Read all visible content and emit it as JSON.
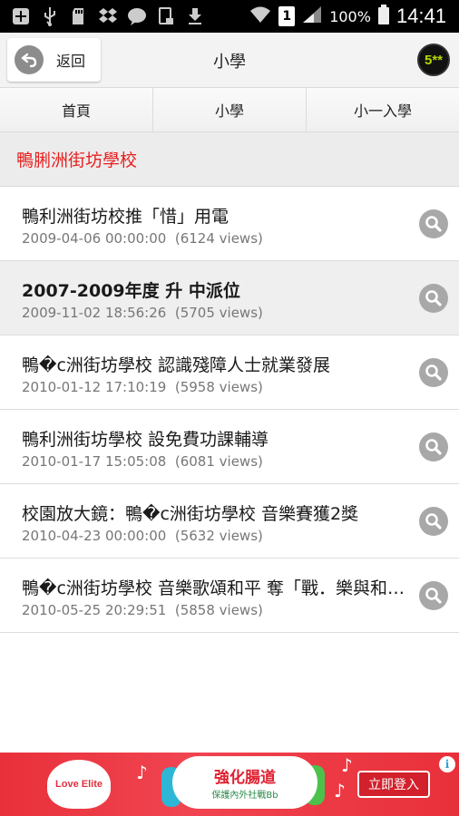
{
  "status_bar": {
    "battery_percent": "100%",
    "time": "14:41",
    "sim_label": "1",
    "icons": [
      "add-icon",
      "usb-icon",
      "sd-card-icon",
      "dropbox-icon",
      "chat-icon",
      "screenshot-icon",
      "download-icon",
      "wifi-icon",
      "signal-icon",
      "battery-icon"
    ]
  },
  "action_bar": {
    "back_label": "返回",
    "title": "小學",
    "brand_badge": "5**"
  },
  "tabs": [
    {
      "label": "首頁"
    },
    {
      "label": "小學"
    },
    {
      "label": "小一入學"
    }
  ],
  "section": {
    "title": "鴨脷洲街坊學校",
    "title_color": "#e82020"
  },
  "articles": [
    {
      "title": "鴨利洲街坊校推「惜」用電",
      "date": "2009-04-06 00:00:00",
      "views": "(6124 views)"
    },
    {
      "title": "2007-2009年度 升 中派位",
      "date": "2009-11-02 18:56:26",
      "views": "(5705 views)"
    },
    {
      "title": "鴨�c洲街坊學校 認識殘障人士就業發展",
      "date": "2010-01-12 17:10:19",
      "views": "(5958 views)"
    },
    {
      "title": "鴨利洲街坊學校 設免費功課輔導",
      "date": "2010-01-17 15:05:08",
      "views": "(6081 views)"
    },
    {
      "title": "校園放大鏡：鴨�c洲街坊學校 音樂賽獲2獎",
      "date": "2010-04-23 00:00:00",
      "views": "(5632 views)"
    },
    {
      "title": "鴨�c洲街坊學校 音樂歌頌和平 奪「戰．樂與和平」創作比賽冠軍",
      "date": "2010-05-25 20:29:51",
      "views": "(5858 views)"
    }
  ],
  "ad": {
    "logo_text": "Love Elite",
    "headline": "強化腸道",
    "subline": "保護內外社戰Bb",
    "cta": "立即登入",
    "info": "i"
  },
  "colors": {
    "accent_red": "#e82020",
    "ad_red": "#e8303a"
  }
}
